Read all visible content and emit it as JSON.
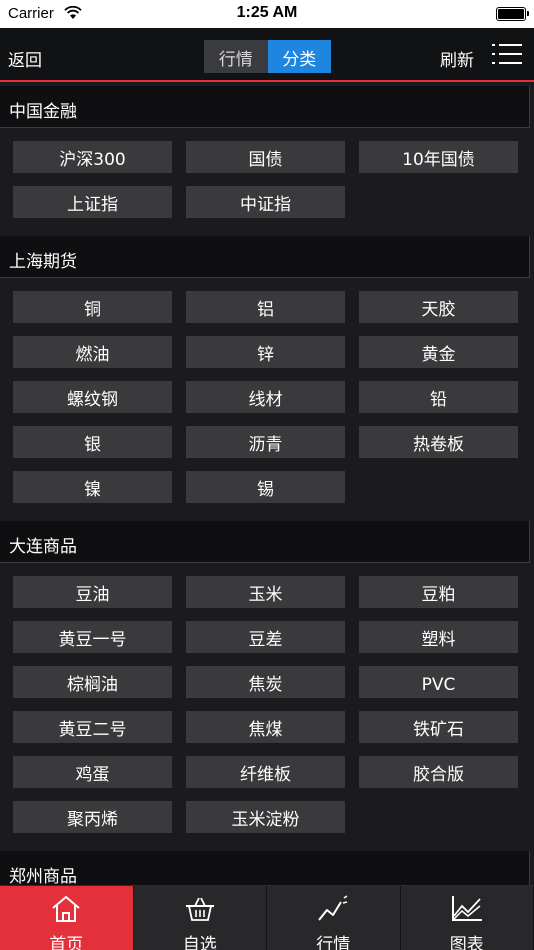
{
  "status_bar": {
    "carrier": "Carrier",
    "time": "1:25 AM"
  },
  "nav": {
    "back": "返回",
    "segments": [
      "行情",
      "分类"
    ],
    "refresh": "刷新"
  },
  "sections": [
    {
      "title": "中国金融",
      "items": [
        "沪深300",
        "国债",
        "10年国债",
        "上证指",
        "中证指"
      ]
    },
    {
      "title": "上海期货",
      "items": [
        "铜",
        "铝",
        "天胶",
        "燃油",
        "锌",
        "黄金",
        "螺纹钢",
        "线材",
        "铅",
        "银",
        "沥青",
        "热卷板",
        "镍",
        "锡"
      ]
    },
    {
      "title": "大连商品",
      "items": [
        "豆油",
        "玉米",
        "豆粕",
        "黄豆一号",
        "豆差",
        "塑料",
        "棕榈油",
        "焦炭",
        "PVC",
        "黄豆二号",
        "焦煤",
        "铁矿石",
        "鸡蛋",
        "纤维板",
        "胶合版",
        "聚丙烯",
        "玉米淀粉"
      ]
    },
    {
      "title": "郑州商品",
      "items": []
    }
  ],
  "tabs": [
    {
      "label": "首页",
      "icon": "home-icon"
    },
    {
      "label": "自选",
      "icon": "basket-icon"
    },
    {
      "label": "行情",
      "icon": "trend-line-icon"
    },
    {
      "label": "图表",
      "icon": "area-chart-icon"
    }
  ],
  "colors": {
    "accent": "#e3303b",
    "segment_active": "#1e86de"
  }
}
